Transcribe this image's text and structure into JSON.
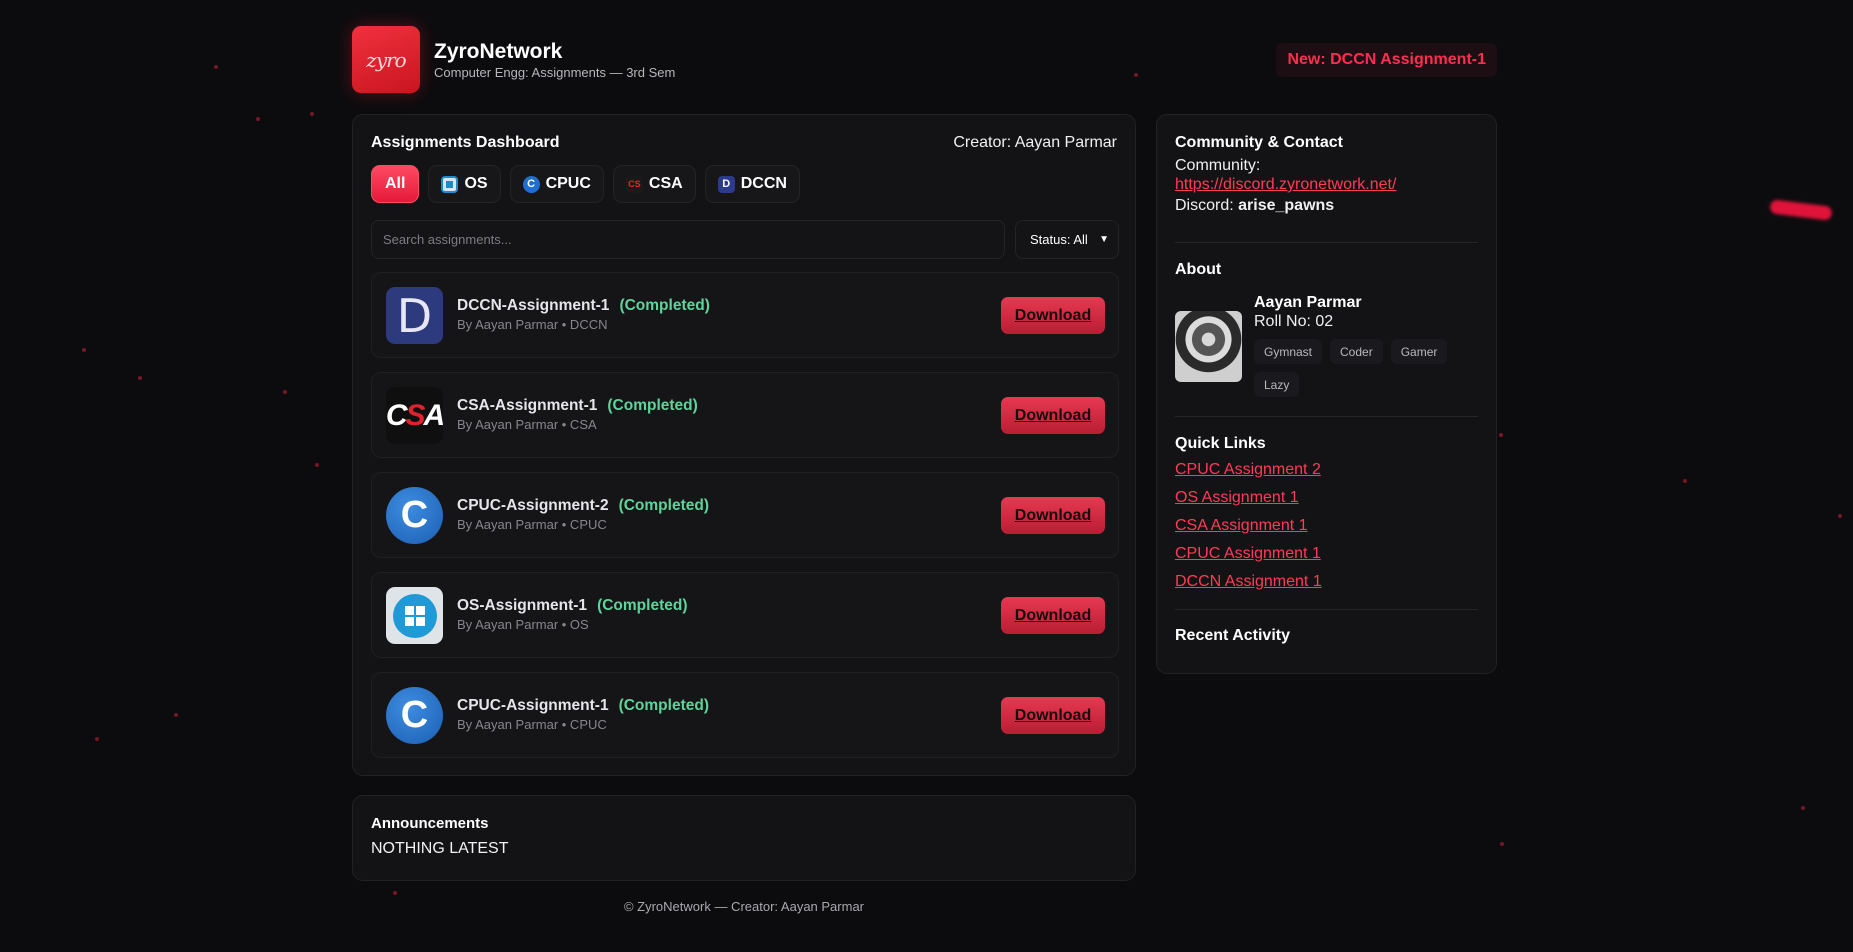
{
  "brand": {
    "logo_text": "zyro",
    "name": "ZyroNetwork",
    "subtitle": "Computer Engg: Assignments — 3rd Sem"
  },
  "news_badge": "New: DCCN Assignment-1",
  "dashboard": {
    "title": "Assignments Dashboard",
    "creator": "Creator: Aayan Parmar",
    "tabs": [
      {
        "label": "All",
        "icon": "all"
      },
      {
        "label": "OS",
        "icon": "windows-icon"
      },
      {
        "label": "CPUC",
        "icon": "c-lang-icon"
      },
      {
        "label": "CSA",
        "icon": "csa-icon"
      },
      {
        "label": "DCCN",
        "icon": "dccn-icon"
      }
    ],
    "search_placeholder": "Search assignments...",
    "status_filter": "Status: All",
    "assignments": [
      {
        "title": "DCCN-Assignment-1",
        "status": "(Completed)",
        "meta": "By Aayan Parmar • DCCN",
        "thumb_text": "D",
        "action": "Download"
      },
      {
        "title": "CSA-Assignment-1",
        "status": "(Completed)",
        "meta": "By Aayan Parmar • CSA",
        "thumb_text": "CSA",
        "action": "Download"
      },
      {
        "title": "CPUC-Assignment-2",
        "status": "(Completed)",
        "meta": "By Aayan Parmar • CPUC",
        "thumb_text": "C",
        "action": "Download"
      },
      {
        "title": "OS-Assignment-1",
        "status": "(Completed)",
        "meta": "By Aayan Parmar • OS",
        "thumb_text": "",
        "action": "Download"
      },
      {
        "title": "CPUC-Assignment-1",
        "status": "(Completed)",
        "meta": "By Aayan Parmar • CPUC",
        "thumb_text": "C",
        "action": "Download"
      }
    ]
  },
  "announcements": {
    "title": "Announcements",
    "text": "NOTHING LATEST"
  },
  "footer": "© ZyroNetwork — Creator: Aayan Parmar",
  "sidebar": {
    "contact_title": "Community & Contact",
    "community_label": "Community:",
    "community_url": "https://discord.zyronetwork.net/",
    "discord_label": "Discord:",
    "discord_handle": "arise_pawns",
    "about_title": "About",
    "profile": {
      "name": "Aayan Parmar",
      "roll": "Roll No: 02",
      "tags": [
        "Gymnast",
        "Coder",
        "Gamer",
        "Lazy"
      ]
    },
    "quick_links_title": "Quick Links",
    "quick_links": [
      "CPUC Assignment 2",
      "OS Assignment 1",
      "CSA Assignment 1",
      "CPUC Assignment 1",
      "DCCN Assignment 1"
    ],
    "recent_activity_title": "Recent Activity"
  },
  "colors": {
    "accent": "#ff2e50",
    "completed": "#5fd49a",
    "background": "#0c0c0e",
    "panel": "#131316"
  }
}
